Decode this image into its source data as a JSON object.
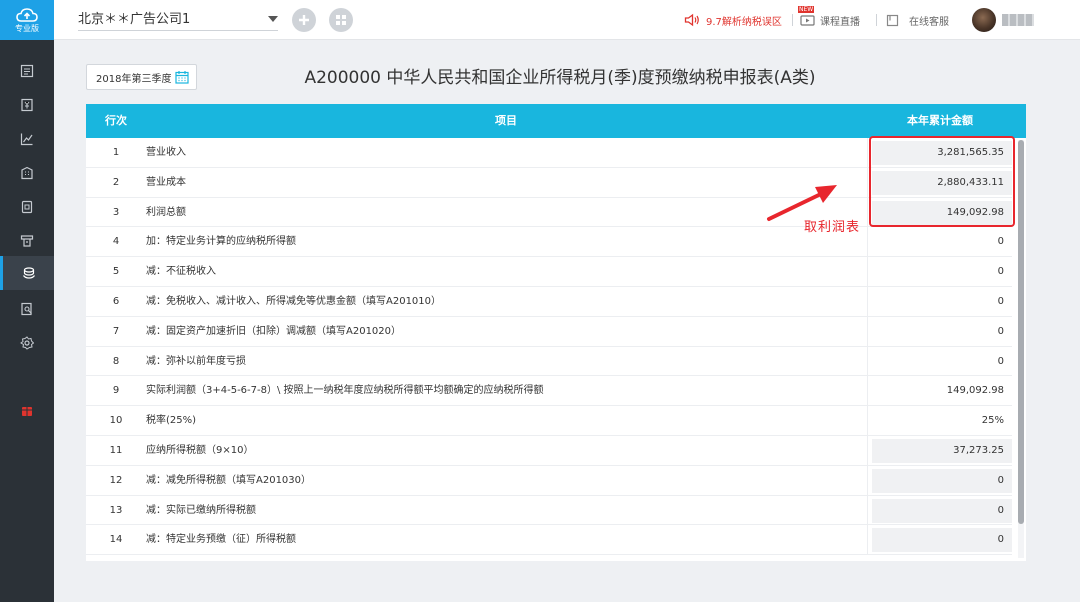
{
  "app": {
    "logo_label": "专业版"
  },
  "sidebar": {
    "items": [
      {
        "icon": "ledger-icon",
        "active": false
      },
      {
        "icon": "voucher-icon",
        "active": false
      },
      {
        "icon": "chart-icon",
        "active": false
      },
      {
        "icon": "building-icon",
        "active": false
      },
      {
        "icon": "invoice-icon",
        "active": false
      },
      {
        "icon": "print-icon",
        "active": false
      },
      {
        "icon": "tax-coins-icon",
        "active": true
      },
      {
        "icon": "search-doc-icon",
        "active": false
      },
      {
        "icon": "gear-icon",
        "active": false
      },
      {
        "icon": "gift-icon",
        "active": false
      }
    ]
  },
  "topbar": {
    "company": "北京＊＊广告公司1",
    "promo": "9.7解析纳税误区",
    "live_label": "课程直播",
    "new_tag": "NEW",
    "service_label": "在线客服"
  },
  "form": {
    "period": "2018年第三季度",
    "title": "A200000 中华人民共和国企业所得税月(季)度预缴纳税申报表(A类)"
  },
  "table": {
    "headers": {
      "no": "行次",
      "item": "项目",
      "amount": "本年累计金额"
    },
    "rows": [
      {
        "no": "1",
        "item": "营业收入",
        "amount": "3,281,565.35",
        "shaded": true
      },
      {
        "no": "2",
        "item": "营业成本",
        "amount": "2,880,433.11",
        "shaded": true
      },
      {
        "no": "3",
        "item": "利润总额",
        "amount": "149,092.98",
        "shaded": true
      },
      {
        "no": "4",
        "item": "加：特定业务计算的应纳税所得额",
        "amount": "0",
        "shaded": false
      },
      {
        "no": "5",
        "item": "减：不征税收入",
        "amount": "0",
        "shaded": false
      },
      {
        "no": "6",
        "item": "减：免税收入、减计收入、所得减免等优惠金额（填写A201010）",
        "amount": "0",
        "shaded": false
      },
      {
        "no": "7",
        "item": "减：固定资产加速折旧（扣除）调减额（填写A201020）",
        "amount": "0",
        "shaded": false
      },
      {
        "no": "8",
        "item": "减：弥补以前年度亏损",
        "amount": "0",
        "shaded": false
      },
      {
        "no": "9",
        "item": "实际利润额（3+4-5-6-7-8）\\ 按照上一纳税年度应纳税所得额平均额确定的应纳税所得额",
        "amount": "149,092.98",
        "shaded": false
      },
      {
        "no": "10",
        "item": "税率(25%)",
        "amount": "25%",
        "shaded": false
      },
      {
        "no": "11",
        "item": "应纳所得税额（9×10）",
        "amount": "37,273.25",
        "shaded": true
      },
      {
        "no": "12",
        "item": "减：减免所得税额（填写A201030）",
        "amount": "0",
        "shaded": true
      },
      {
        "no": "13",
        "item": "减：实际已缴纳所得税额",
        "amount": "0",
        "shaded": true
      },
      {
        "no": "14",
        "item": "减：特定业务预缴（征）所得税额",
        "amount": "0",
        "shaded": true
      }
    ]
  },
  "annotation": {
    "note": "取利润表",
    "color": "#e8262d"
  },
  "colors": {
    "accent": "#19b6de",
    "sidebar": "#2b3137",
    "promo": "#e0342e"
  }
}
